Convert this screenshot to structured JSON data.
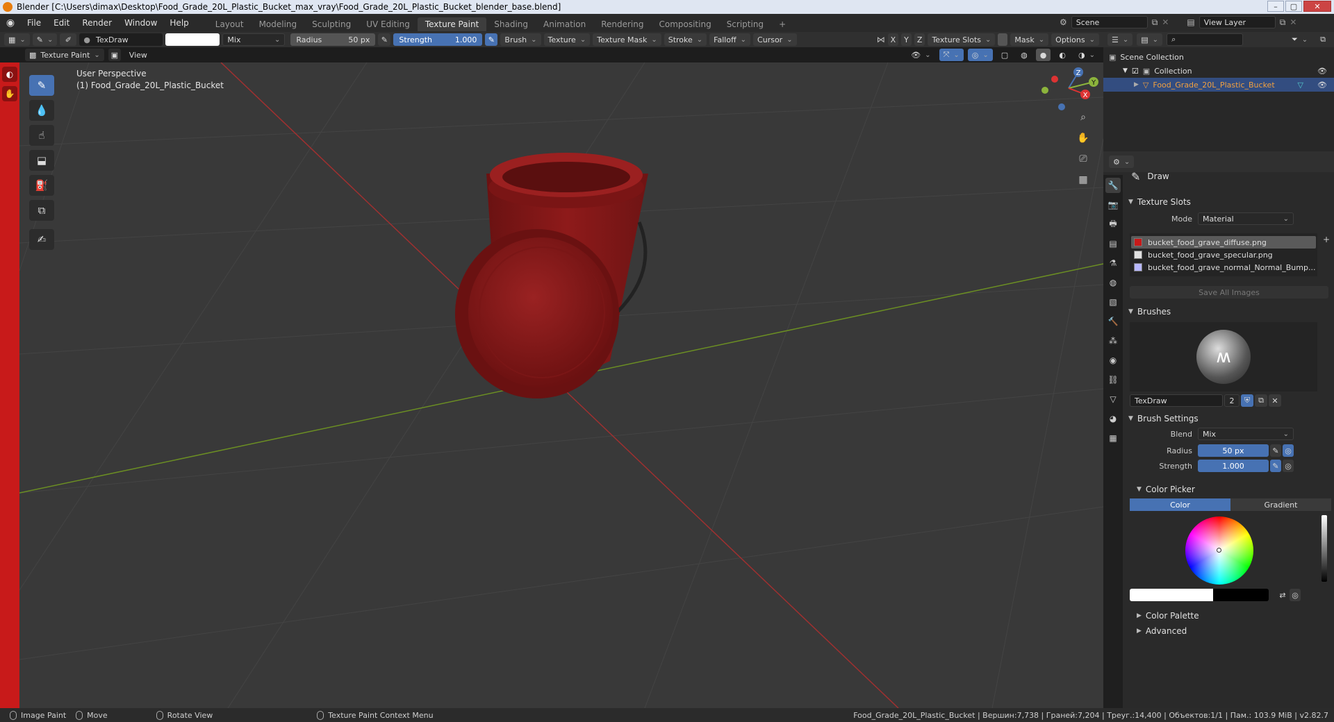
{
  "window": {
    "title": "Blender [C:\\Users\\dimax\\Desktop\\Food_Grade_20L_Plastic_Bucket_max_vray\\Food_Grade_20L_Plastic_Bucket_blender_base.blend]"
  },
  "menu": {
    "items": [
      "File",
      "Edit",
      "Render",
      "Window",
      "Help"
    ]
  },
  "workspaces": {
    "tabs": [
      "Layout",
      "Modeling",
      "Sculpting",
      "UV Editing",
      "Texture Paint",
      "Shading",
      "Animation",
      "Rendering",
      "Compositing",
      "Scripting"
    ],
    "active": "Texture Paint",
    "add": "+"
  },
  "scene": {
    "name": "Scene",
    "view_layer": "View Layer"
  },
  "toolheader": {
    "brush_name": "TexDraw",
    "blend": "Mix",
    "radius_label": "Radius",
    "radius_value": "50 px",
    "strength_label": "Strength",
    "strength_value": "1.000",
    "menus": [
      "Brush",
      "Texture",
      "Texture Mask",
      "Stroke",
      "Falloff",
      "Cursor"
    ],
    "axes": [
      "X",
      "Y",
      "Z"
    ],
    "texture_slots": "Texture Slots",
    "mask": "Mask",
    "options": "Options"
  },
  "viewport_header": {
    "mode": "Texture Paint",
    "view": "View"
  },
  "viewport": {
    "perspective": "User Perspective",
    "object_label": "(1) Food_Grade_20L_Plastic_Bucket",
    "gizmo": {
      "x": "X",
      "y": "Y",
      "z": "Z"
    }
  },
  "outliner": {
    "scene_collection": "Scene Collection",
    "collection": "Collection",
    "object": "Food_Grade_20L_Plastic_Bucket"
  },
  "properties": {
    "tool_name": "Draw",
    "texture_slots": {
      "title": "Texture Slots",
      "mode_label": "Mode",
      "mode_value": "Material",
      "slots": [
        {
          "name": "bucket_food_grave_diffuse.png",
          "color": "#c81a1a"
        },
        {
          "name": "bucket_food_grave_specular.png",
          "color": "#e0e0e0"
        },
        {
          "name": "bucket_food_grave_normal_Normal_Bump...",
          "color": "#b8b8ff"
        }
      ],
      "save_all": "Save All Images"
    },
    "brushes": {
      "title": "Brushes",
      "brush_name": "TexDraw",
      "users": "2"
    },
    "brush_settings": {
      "title": "Brush Settings",
      "blend_label": "Blend",
      "blend_value": "Mix",
      "radius_label": "Radius",
      "radius_value": "50 px",
      "strength_label": "Strength",
      "strength_value": "1.000"
    },
    "color_picker": {
      "title": "Color Picker",
      "tab_color": "Color",
      "tab_gradient": "Gradient"
    },
    "color_palette": "Color Palette",
    "advanced": "Advanced"
  },
  "statusbar": {
    "image_paint": "Image Paint",
    "move": "Move",
    "rotate_view": "Rotate View",
    "context_menu": "Texture Paint Context Menu",
    "stats": "Food_Grade_20L_Plastic_Bucket | Вершин:7,738 | Граней:7,204 | Треуг.:14,400 | Объектов:1/1 | Пам.: 103.9 MiB | v2.82.7"
  },
  "colors": {
    "accent": "#4772b3",
    "bucket_red": "#8e1a1a",
    "selected_object": "#f0a040"
  }
}
